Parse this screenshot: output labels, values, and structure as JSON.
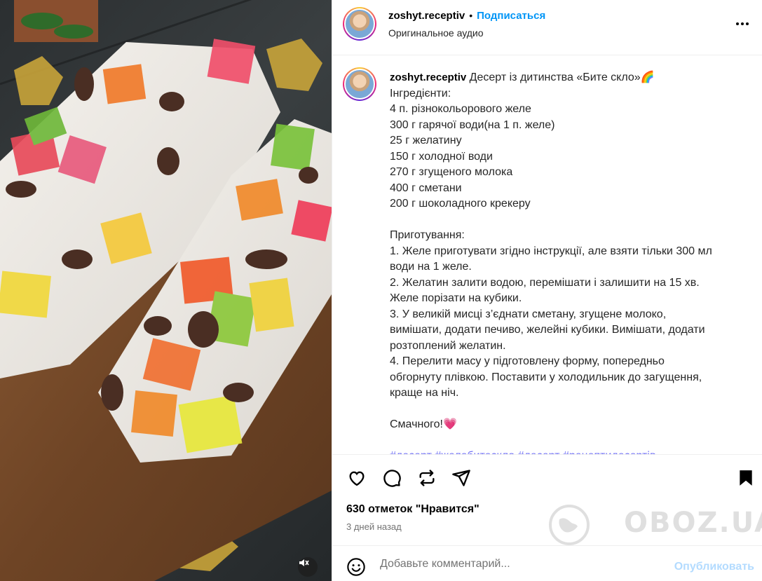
{
  "post": {
    "username": "zoshyt.receptiv",
    "follow_label": "Подписаться",
    "separator": "•",
    "audio_label": "Оригинальное аудио",
    "caption": {
      "username": "zoshyt.receptiv",
      "title": "Десерт із дитинства «Бите скло»🌈",
      "lines": [
        "Інгредієнти:",
        "4 п. різнокольорового желе",
        "300 г гарячої води(на 1 п. желе)",
        "25 г желатину",
        "150 г холодної води",
        "270 г згущеного молока",
        "400 г сметани",
        "200 г шоколадного крекеру",
        "",
        "Приготування:",
        "1. Желе приготувати згідно інструкції, але взяти тільки 300 мл",
        "води на 1 желе.",
        "2. Желатин залити водою, перемішати і залишити на 15 хв.",
        "Желе порізати на кубики.",
        "3. У великій мисці з’єднати сметану, згущене молоко,",
        "вимішати, додати печиво, желейні кубики. Вимішати, додати",
        "розтоплений желатин.",
        "4. Перелити масу у підготовлену форму, попередньо",
        "обгорнуту плівкою. Поставити у холодильник до загущення,",
        "краще на ніч.",
        "",
        "Смачного!💗",
        ""
      ],
      "hashtags": "#десерт #желебитескло #десерт #рецептидесертів"
    },
    "likes": "630 отметок \"Нравится\"",
    "time_ago": "3 дней назад",
    "comment_placeholder": "Добавьте комментарий...",
    "publish_label": "Опубликовать",
    "watermark": "OBOZ.UA"
  },
  "icons": {
    "like": "heart-icon",
    "comment": "comment-icon",
    "repost": "repost-icon",
    "share": "send-icon",
    "save": "bookmark-icon",
    "more": "more-icon",
    "emoji": "emoji-icon",
    "mute": "muted-speaker-icon"
  },
  "colors": {
    "accent": "#0095f6",
    "publish_disabled": "#b3dbff",
    "hashtag": "#6e6ef5",
    "secondary_text": "#737373"
  }
}
